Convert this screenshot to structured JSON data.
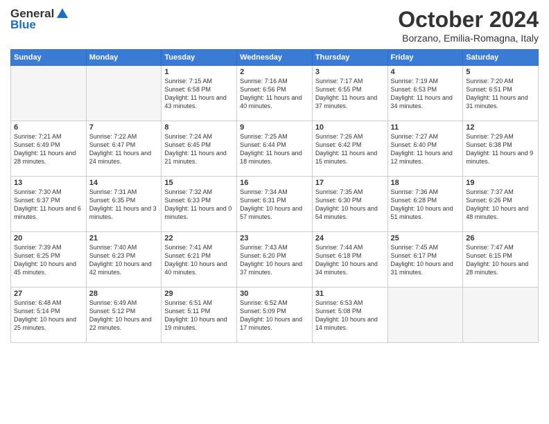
{
  "logo": {
    "general": "General",
    "blue": "Blue"
  },
  "title": "October 2024",
  "location": "Borzano, Emilia-Romagna, Italy",
  "days_of_week": [
    "Sunday",
    "Monday",
    "Tuesday",
    "Wednesday",
    "Thursday",
    "Friday",
    "Saturday"
  ],
  "weeks": [
    [
      {
        "day": "",
        "empty": true
      },
      {
        "day": "",
        "empty": true
      },
      {
        "day": "1",
        "sunrise": "7:15 AM",
        "sunset": "6:58 PM",
        "daylight": "11 hours and 43 minutes."
      },
      {
        "day": "2",
        "sunrise": "7:16 AM",
        "sunset": "6:56 PM",
        "daylight": "11 hours and 40 minutes."
      },
      {
        "day": "3",
        "sunrise": "7:17 AM",
        "sunset": "6:55 PM",
        "daylight": "11 hours and 37 minutes."
      },
      {
        "day": "4",
        "sunrise": "7:19 AM",
        "sunset": "6:53 PM",
        "daylight": "11 hours and 34 minutes."
      },
      {
        "day": "5",
        "sunrise": "7:20 AM",
        "sunset": "6:51 PM",
        "daylight": "11 hours and 31 minutes."
      }
    ],
    [
      {
        "day": "6",
        "sunrise": "7:21 AM",
        "sunset": "6:49 PM",
        "daylight": "11 hours and 28 minutes."
      },
      {
        "day": "7",
        "sunrise": "7:22 AM",
        "sunset": "6:47 PM",
        "daylight": "11 hours and 24 minutes."
      },
      {
        "day": "8",
        "sunrise": "7:24 AM",
        "sunset": "6:45 PM",
        "daylight": "11 hours and 21 minutes."
      },
      {
        "day": "9",
        "sunrise": "7:25 AM",
        "sunset": "6:44 PM",
        "daylight": "11 hours and 18 minutes."
      },
      {
        "day": "10",
        "sunrise": "7:26 AM",
        "sunset": "6:42 PM",
        "daylight": "11 hours and 15 minutes."
      },
      {
        "day": "11",
        "sunrise": "7:27 AM",
        "sunset": "6:40 PM",
        "daylight": "11 hours and 12 minutes."
      },
      {
        "day": "12",
        "sunrise": "7:29 AM",
        "sunset": "6:38 PM",
        "daylight": "11 hours and 9 minutes."
      }
    ],
    [
      {
        "day": "13",
        "sunrise": "7:30 AM",
        "sunset": "6:37 PM",
        "daylight": "11 hours and 6 minutes."
      },
      {
        "day": "14",
        "sunrise": "7:31 AM",
        "sunset": "6:35 PM",
        "daylight": "11 hours and 3 minutes."
      },
      {
        "day": "15",
        "sunrise": "7:32 AM",
        "sunset": "6:33 PM",
        "daylight": "11 hours and 0 minutes."
      },
      {
        "day": "16",
        "sunrise": "7:34 AM",
        "sunset": "6:31 PM",
        "daylight": "10 hours and 57 minutes."
      },
      {
        "day": "17",
        "sunrise": "7:35 AM",
        "sunset": "6:30 PM",
        "daylight": "10 hours and 54 minutes."
      },
      {
        "day": "18",
        "sunrise": "7:36 AM",
        "sunset": "6:28 PM",
        "daylight": "10 hours and 51 minutes."
      },
      {
        "day": "19",
        "sunrise": "7:37 AM",
        "sunset": "6:26 PM",
        "daylight": "10 hours and 48 minutes."
      }
    ],
    [
      {
        "day": "20",
        "sunrise": "7:39 AM",
        "sunset": "6:25 PM",
        "daylight": "10 hours and 45 minutes."
      },
      {
        "day": "21",
        "sunrise": "7:40 AM",
        "sunset": "6:23 PM",
        "daylight": "10 hours and 42 minutes."
      },
      {
        "day": "22",
        "sunrise": "7:41 AM",
        "sunset": "6:21 PM",
        "daylight": "10 hours and 40 minutes."
      },
      {
        "day": "23",
        "sunrise": "7:43 AM",
        "sunset": "6:20 PM",
        "daylight": "10 hours and 37 minutes."
      },
      {
        "day": "24",
        "sunrise": "7:44 AM",
        "sunset": "6:18 PM",
        "daylight": "10 hours and 34 minutes."
      },
      {
        "day": "25",
        "sunrise": "7:45 AM",
        "sunset": "6:17 PM",
        "daylight": "10 hours and 31 minutes."
      },
      {
        "day": "26",
        "sunrise": "7:47 AM",
        "sunset": "6:15 PM",
        "daylight": "10 hours and 28 minutes."
      }
    ],
    [
      {
        "day": "27",
        "sunrise": "6:48 AM",
        "sunset": "5:14 PM",
        "daylight": "10 hours and 25 minutes."
      },
      {
        "day": "28",
        "sunrise": "6:49 AM",
        "sunset": "5:12 PM",
        "daylight": "10 hours and 22 minutes."
      },
      {
        "day": "29",
        "sunrise": "6:51 AM",
        "sunset": "5:11 PM",
        "daylight": "10 hours and 19 minutes."
      },
      {
        "day": "30",
        "sunrise": "6:52 AM",
        "sunset": "5:09 PM",
        "daylight": "10 hours and 17 minutes."
      },
      {
        "day": "31",
        "sunrise": "6:53 AM",
        "sunset": "5:08 PM",
        "daylight": "10 hours and 14 minutes."
      },
      {
        "day": "",
        "empty": true
      },
      {
        "day": "",
        "empty": true
      }
    ]
  ]
}
